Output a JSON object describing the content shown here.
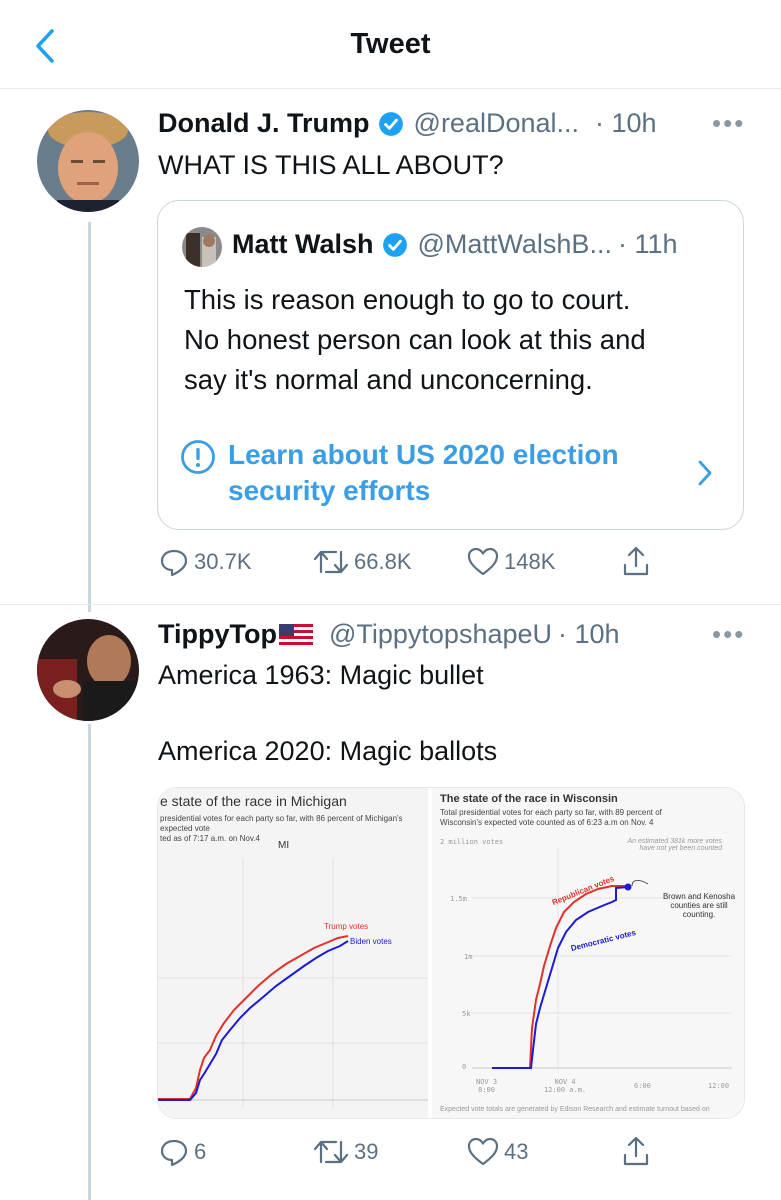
{
  "header": {
    "title": "Tweet",
    "back_icon": "chevron-left-icon"
  },
  "tweet1": {
    "name": "Donald J. Trump",
    "handle": "@realDonal...",
    "time": "· 10h",
    "text": "WHAT IS THIS ALL ABOUT?",
    "verified": true,
    "quote": {
      "name": "Matt Walsh",
      "handle": "@MattWalshB...",
      "time": "· 11h",
      "text": "This is reason enough to go to court.\nNo honest person can look at this and\nsay it's normal and unconcerning.",
      "notice": "Learn about US 2020 election\nsecurity efforts"
    },
    "replies": "30.7K",
    "retweets": "66.8K",
    "likes": "148K"
  },
  "tweet2": {
    "name": "TippyTop",
    "flag": "🇺🇸",
    "handle": "@TippytopshapeU",
    "time": "· 10h",
    "text": "America 1963: Magic bullet\n\nAmerica 2020: Magic ballots",
    "replies": "6",
    "retweets": "39",
    "likes": "43",
    "media": {
      "left": {
        "title": "e state of the race in Michigan",
        "subtitle": "presidential votes for each party so far, with 86 percent of Michigan's expected vote\nted as of 7:17 a.m. on Nov.4",
        "label": "MI",
        "trump_label": "Trump votes",
        "biden_label": "Biden votes"
      },
      "right": {
        "title": "The state of the race in Wisconsin",
        "subtitle": "Total presidential votes for each party so far, with 89 percent of\nWisconsin's expected vote counted as of 6:23 a.m on Nov. 4",
        "top_left": "2 million votes",
        "top_right": "An estimated 381k more votes\nhave not yet been counted",
        "y_ticks": [
          "1.5m",
          "1m",
          "5k",
          "0"
        ],
        "x_ticks": [
          "NOV 3\n8:00",
          "NOV 4\n12:00 a.m.",
          "6:00",
          "12:00"
        ],
        "rep_label": "Republican votes",
        "dem_label": "Democratic votes",
        "annotation": "Brown and Kenosha\ncounties are still counting.",
        "footer": "Expected vote totals are generated by Edison Research and estimate turnout based on"
      }
    }
  },
  "colors": {
    "accent": "#1da1f2",
    "trump": "#e0312a",
    "biden": "#1a1ad8"
  }
}
